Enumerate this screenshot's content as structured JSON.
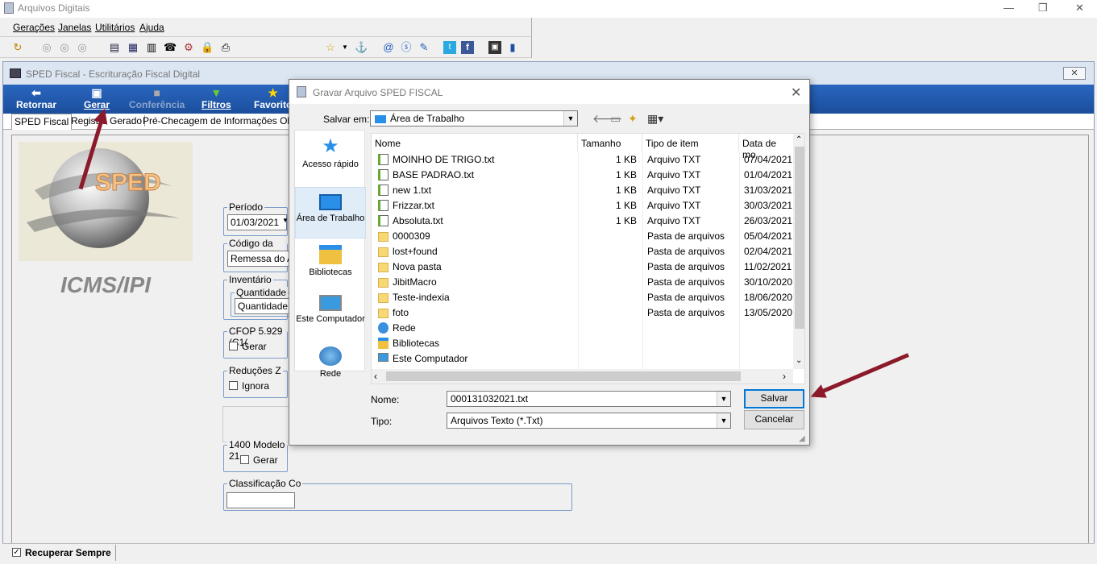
{
  "app": {
    "title": "Arquivos Digitais"
  },
  "menu": [
    "Gerações",
    "Janelas",
    "Utilitários",
    "Ajuda"
  ],
  "mdi": {
    "title": "SPED Fiscal - Escrituração Fiscal Digital"
  },
  "ribbon": {
    "retornar": "Retornar",
    "gerar": "Gerar",
    "conferencia": "Conferência",
    "filtros": "Filtros",
    "favoritos": "Favorito"
  },
  "tabs": [
    "SPED Fiscal",
    "Registro Gerado",
    "Pré-Checagem de Informações Obrigat"
  ],
  "logo": {
    "text": "SPED",
    "caption": "ICMS/IPI"
  },
  "form": {
    "periodo_label": "Período",
    "periodo_value": "01/03/2021",
    "finalidade_label": "Código da Finalid",
    "finalidade_value": "Remessa do Ar",
    "inventario_label": "Inventário",
    "quantidade_label": "Quantidade",
    "quantidade_value": "Quantidade Co",
    "cfop_label": "CFOP 5.929 (C1(",
    "cfop_check": "Gerar",
    "reducoes_label": "Reduções Z",
    "reducoes_check": "Ignora",
    "modelo_label": "1400 Modelo 21",
    "modelo_check": "Gerar",
    "classificacao_label": "Classificação Co"
  },
  "status": {
    "recuperar": "Recuperar Sempre"
  },
  "dialog": {
    "title": "Gravar Arquivo SPED FISCAL",
    "save_in_label": "Salvar em:",
    "save_in_value": "Área de Trabalho",
    "places": [
      "Acesso rápido",
      "Área de Trabalho",
      "Bibliotecas",
      "Este Computador",
      "Rede"
    ],
    "columns": [
      "Nome",
      "Tamanho",
      "Tipo de item",
      "Data de mo"
    ],
    "files": [
      {
        "name": "MOINHO DE TRIGO.txt",
        "size": "1 KB",
        "type": "Arquivo TXT",
        "date": "07/04/2021",
        "kind": "txt"
      },
      {
        "name": "BASE PADRAO.txt",
        "size": "1 KB",
        "type": "Arquivo TXT",
        "date": "01/04/2021",
        "kind": "txt"
      },
      {
        "name": "new 1.txt",
        "size": "1 KB",
        "type": "Arquivo TXT",
        "date": "31/03/2021",
        "kind": "txt"
      },
      {
        "name": "Frizzar.txt",
        "size": "1 KB",
        "type": "Arquivo TXT",
        "date": "30/03/2021",
        "kind": "txt"
      },
      {
        "name": "Absoluta.txt",
        "size": "1 KB",
        "type": "Arquivo TXT",
        "date": "26/03/2021",
        "kind": "txt"
      },
      {
        "name": "0000309",
        "size": "",
        "type": "Pasta de arquivos",
        "date": "05/04/2021",
        "kind": "folder"
      },
      {
        "name": "lost+found",
        "size": "",
        "type": "Pasta de arquivos",
        "date": "02/04/2021",
        "kind": "folder"
      },
      {
        "name": "Nova pasta",
        "size": "",
        "type": "Pasta de arquivos",
        "date": "11/02/2021",
        "kind": "folder"
      },
      {
        "name": "JibitMacro",
        "size": "",
        "type": "Pasta de arquivos",
        "date": "30/10/2020",
        "kind": "folder"
      },
      {
        "name": "Teste-indexia",
        "size": "",
        "type": "Pasta de arquivos",
        "date": "18/06/2020",
        "kind": "folder"
      },
      {
        "name": "foto",
        "size": "",
        "type": "Pasta de arquivos",
        "date": "13/05/2020",
        "kind": "folder"
      },
      {
        "name": "Rede",
        "size": "",
        "type": "",
        "date": "",
        "kind": "network"
      },
      {
        "name": "Bibliotecas",
        "size": "",
        "type": "",
        "date": "",
        "kind": "library"
      },
      {
        "name": "Este Computador",
        "size": "",
        "type": "",
        "date": "",
        "kind": "computer"
      }
    ],
    "name_label": "Nome:",
    "name_value": "000131032021.txt",
    "type_label": "Tipo:",
    "type_value": "Arquivos Texto (*.Txt)",
    "save_button": "Salvar",
    "cancel_button": "Cancelar"
  }
}
